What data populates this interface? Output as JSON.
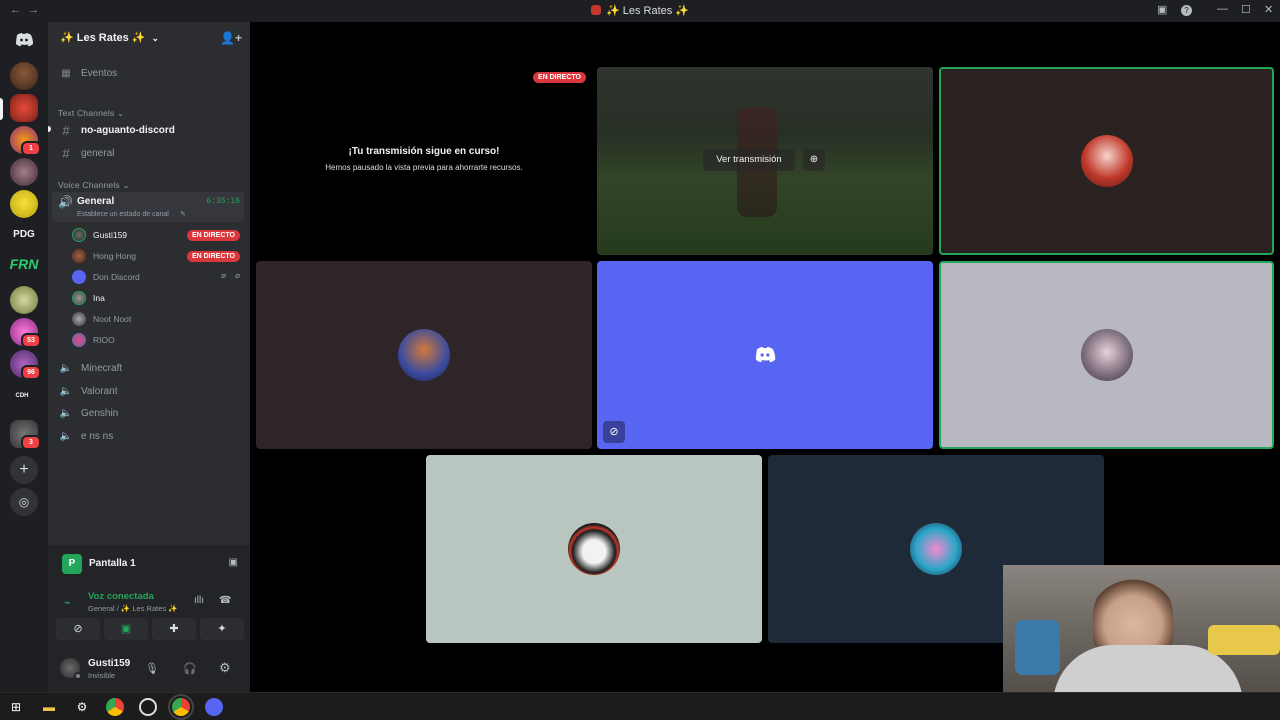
{
  "window": {
    "title": "✨ Les Rates ✨",
    "nav_back": "←",
    "nav_forward": "→"
  },
  "guilds": {
    "pdg_label": "PDG",
    "frn_label": "FRN",
    "cdh_label": "CDH",
    "badges": [
      "1",
      "53",
      "96",
      "3"
    ]
  },
  "server": {
    "name": "✨ Les Rates ✨",
    "events_label": "Eventos",
    "text_category": "Text Channels",
    "text_channels": [
      "no-aguanto-discord",
      "general"
    ],
    "voice_category": "Voice Channels",
    "active_voice": {
      "name": "General",
      "timer": "6:35:16",
      "status": "Establece un estado de canal"
    },
    "voice_users": [
      {
        "name": "Gusti159",
        "live": "EN DIRECTO"
      },
      {
        "name": "Hong Hong",
        "live": "EN DIRECTO"
      },
      {
        "name": "Don Discord",
        "live": ""
      },
      {
        "name": "Ina",
        "live": ""
      },
      {
        "name": "Noot Noot",
        "live": ""
      },
      {
        "name": "RIOO",
        "live": ""
      }
    ],
    "voice_channels": [
      "Minecraft",
      "Valorant",
      "Genshin",
      "e ns ns"
    ]
  },
  "panel": {
    "screen_share": "Pantalla 1",
    "voice_status": "Voz conectada",
    "voice_location": "General / ✨ Les Rates ✨",
    "user_name": "Gusti159",
    "user_status": "Invisible"
  },
  "stage": {
    "own_stream_badge": "EN DIRECTO",
    "paused_title": "¡Tu transmisión sigue en curso!",
    "paused_sub": "Hemos pausado la vista previa para ahorrarte recursos.",
    "watch_stream": "Ver transmisión"
  },
  "colors": {
    "accent": "#5865f2",
    "live": "#da373c",
    "speaking": "#23a55a",
    "online": "#23a55a"
  }
}
